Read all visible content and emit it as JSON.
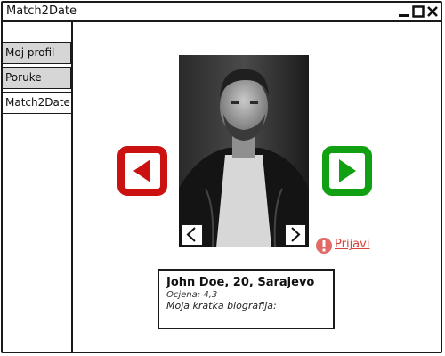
{
  "window": {
    "title": "Match2Date"
  },
  "sidebar": {
    "items": [
      {
        "label": "Moj profil",
        "active": false
      },
      {
        "label": "Poruke",
        "active": false
      },
      {
        "label": "Match2Date",
        "active": true
      }
    ]
  },
  "profile": {
    "photo_icon": "profile-photo",
    "name_line": "John Doe, 20, Sarajevo",
    "rating": "Ocjena: 4,3",
    "bio": "Moja kratka biografija:"
  },
  "actions": {
    "prev_icon": "red-left-arrow-icon",
    "next_icon": "green-right-arrow-icon",
    "report_label": "Prijavi"
  },
  "colors": {
    "reject": "#cc1111",
    "accept": "#11a011",
    "report": "#d9443a",
    "sidebar_inactive": "#d6d6d6"
  }
}
